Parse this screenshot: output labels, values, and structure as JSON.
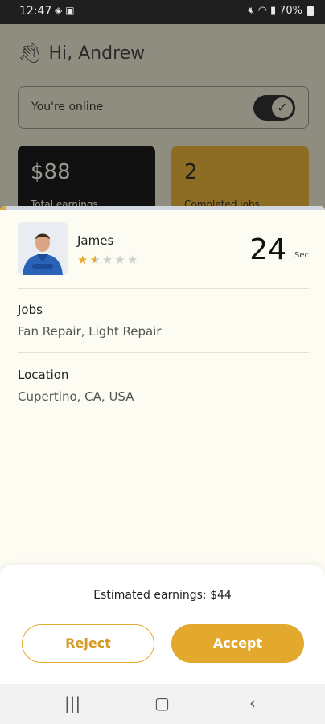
{
  "status_bar": {
    "time": "12:47",
    "left_icons": [
      "navigation-icon",
      "app-icon"
    ],
    "right_icons": [
      "mute-icon",
      "wifi-icon",
      "signal-icon"
    ],
    "battery": "70%"
  },
  "background": {
    "greeting": "Hi, Andrew",
    "online_label": "You're online",
    "online_toggle": true,
    "earnings_value": "$88",
    "earnings_caption": "Total earnings",
    "jobs_value": "2",
    "jobs_caption": "Completed jobs"
  },
  "request": {
    "countdown_progress": 0.02,
    "customer_name": "James",
    "rating": 1.5,
    "rating_max": 5,
    "timer_value": "24",
    "timer_unit": "Sec",
    "jobs_label": "Jobs",
    "jobs_value": "Fan Repair, Light Repair",
    "location_label": "Location",
    "location_value": "Cupertino, CA, USA",
    "estimate_text": "Estimated earnings: $44",
    "reject_label": "Reject",
    "accept_label": "Accept"
  },
  "colors": {
    "accent": "#e3a92f",
    "sheet_bg": "#fdfcf3"
  },
  "nav": [
    "recents-icon",
    "home-icon",
    "back-icon"
  ]
}
